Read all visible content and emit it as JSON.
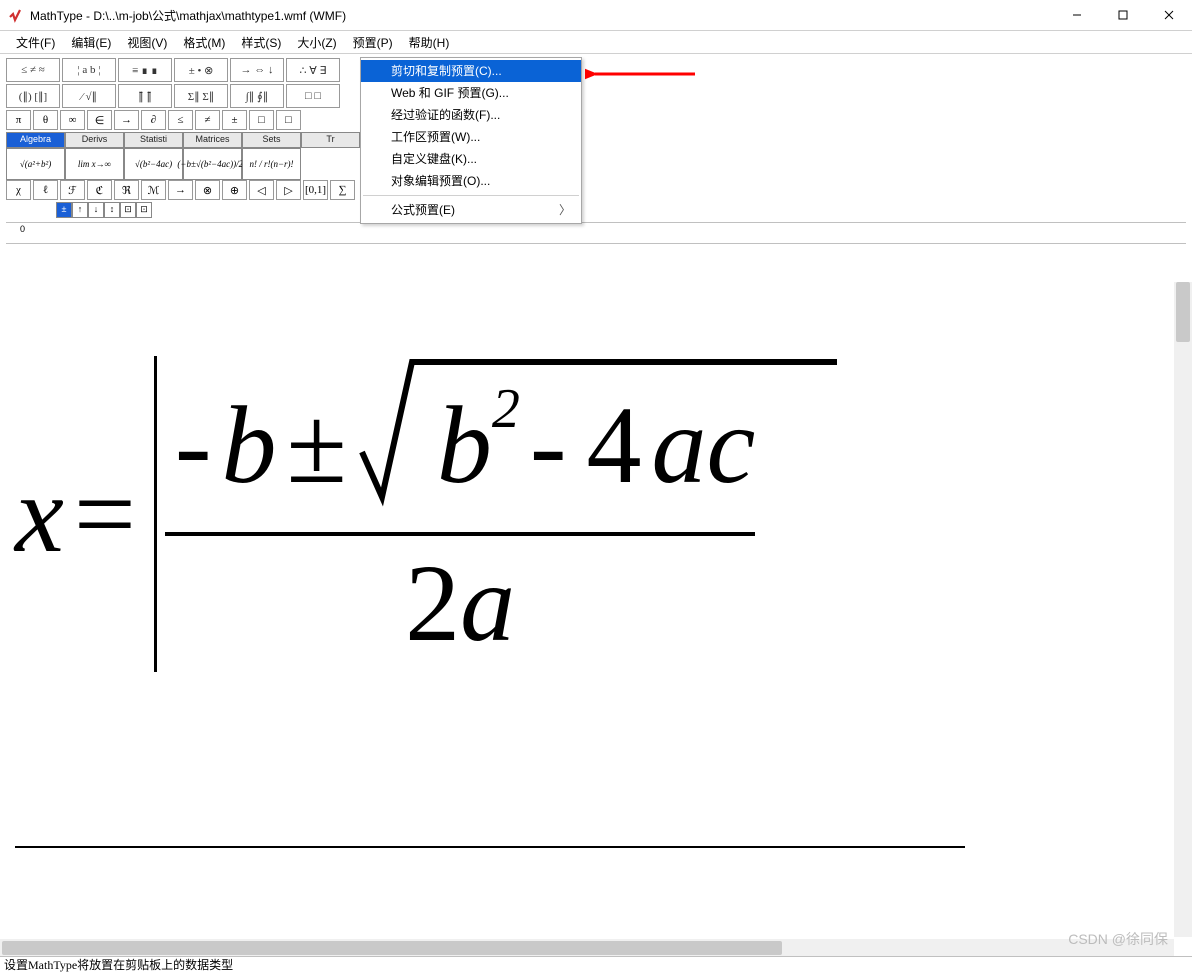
{
  "titlebar": {
    "app_name": "MathType",
    "file_path": "D:\\..\\m-job\\公式\\mathjax\\mathtype1.wmf (WMF)"
  },
  "menubar": {
    "items": [
      "文件(F)",
      "编辑(E)",
      "视图(V)",
      "格式(M)",
      "样式(S)",
      "大小(Z)",
      "预置(P)",
      "帮助(H)"
    ]
  },
  "dropdown": {
    "items": [
      {
        "label": "剪切和复制预置(C)...",
        "selected": true
      },
      {
        "label": "Web 和 GIF 预置(G)..."
      },
      {
        "label": "经过验证的函数(F)..."
      },
      {
        "label": "工作区预置(W)..."
      },
      {
        "label": "自定义键盘(K)..."
      },
      {
        "label": "对象编辑预置(O)..."
      },
      {
        "sep": true
      },
      {
        "label": "公式预置(E)",
        "submenu": true
      }
    ]
  },
  "toolbar": {
    "row1": [
      "≤ ≠ ≈",
      "¦ a b ¦",
      "≡ ∎ ∎",
      "± • ⊗",
      "→ ⇔ ↓",
      "∴ ∀ ∃"
    ],
    "row2": [
      "(∥) [∥]",
      "⁄  √∥",
      "∥̄  ∥̄",
      "Σ∥ Σ∥",
      "∫∥ ∮∥",
      "□  □"
    ],
    "row3": [
      "π",
      "θ",
      "∞",
      "∈",
      "→",
      "∂",
      "≤",
      "≠",
      "±",
      "□",
      "□"
    ],
    "tabs": [
      "Algebra",
      "Derivs",
      "Statisti",
      "Matrices",
      "Sets",
      "Tr"
    ],
    "templates": [
      "√(a²+b²)",
      "lim x→∞",
      "√(b²−4ac)",
      "(−b±√(b²−4ac))/2a",
      "n! / r!(n−r)!"
    ],
    "greek_row": [
      "χ",
      "ℓ",
      "ℱ",
      "ℭ",
      "ℜ",
      "ℳ",
      "→",
      "⊗",
      "⊕",
      "◁",
      "▷",
      "[0,1]",
      "∑"
    ],
    "btm_tabs": [
      "±",
      "↑",
      "↓",
      "↕",
      "⊡",
      "⊡"
    ]
  },
  "ruler": {
    "zero": "0"
  },
  "formula": {
    "lhs_var": "x",
    "equals": "=",
    "num_minus": "-",
    "num_b": "b",
    "num_pm": "±",
    "rad_b": "b",
    "rad_exp": "2",
    "rad_minus": "-",
    "rad_4": "4",
    "rad_a": "a",
    "rad_c": "c",
    "den_2": "2",
    "den_a": "a"
  },
  "status": {
    "text": "设置MathType将放置在剪贴板上的数据类型"
  },
  "watermark": {
    "text": "CSDN @徐同保"
  }
}
